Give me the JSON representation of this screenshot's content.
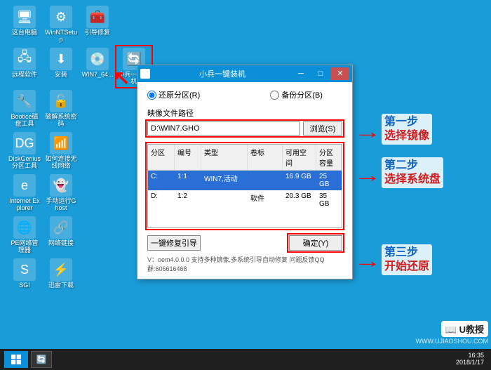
{
  "desktop_icons": [
    {
      "id": "this-pc",
      "label": "这台电脑",
      "row": 0,
      "col": 0,
      "glyph": "🖥"
    },
    {
      "id": "winntsetup",
      "label": "WinNTSetup",
      "row": 0,
      "col": 1,
      "glyph": "⚙"
    },
    {
      "id": "boot-repair",
      "label": "引导修复",
      "row": 0,
      "col": 2,
      "glyph": "🧰"
    },
    {
      "id": "remote-soft",
      "label": "远程软件",
      "row": 1,
      "col": 0,
      "glyph": "🖧"
    },
    {
      "id": "install",
      "label": "安装",
      "row": 1,
      "col": 1,
      "glyph": "⬇"
    },
    {
      "id": "win7-64",
      "label": "WIN7_64...",
      "row": 1,
      "col": 2,
      "glyph": "💿",
      "highlighted": false
    },
    {
      "id": "xiaobing",
      "label": "小兵一键装机",
      "row": 1,
      "col": 3,
      "glyph": "🔄",
      "highlighted": true
    },
    {
      "id": "bootice",
      "label": "Bootice磁盘工具",
      "row": 2,
      "col": 0,
      "glyph": "🔧"
    },
    {
      "id": "crack-pwd",
      "label": "破解系统密码",
      "row": 2,
      "col": 1,
      "glyph": "🔓"
    },
    {
      "id": "diskgenius",
      "label": "DiskGenius分区工具",
      "row": 3,
      "col": 0,
      "glyph": "DG"
    },
    {
      "id": "wifi",
      "label": "如何连接无线网络",
      "row": 3,
      "col": 1,
      "glyph": "📶"
    },
    {
      "id": "ie",
      "label": "Internet Explorer",
      "row": 4,
      "col": 0,
      "glyph": "e"
    },
    {
      "id": "ghost",
      "label": "手动运行Ghost",
      "row": 4,
      "col": 1,
      "glyph": "👻"
    },
    {
      "id": "netmgr",
      "label": "PE网络管理器",
      "row": 5,
      "col": 0,
      "glyph": "🌐"
    },
    {
      "id": "netlink",
      "label": "网络链接",
      "row": 5,
      "col": 1,
      "glyph": "🔗"
    },
    {
      "id": "sgi",
      "label": "SGI",
      "row": 6,
      "col": 0,
      "glyph": "S"
    },
    {
      "id": "xunlei",
      "label": "迅雷下载",
      "row": 6,
      "col": 1,
      "glyph": "⚡"
    }
  ],
  "dialog": {
    "title": "小兵一键装机",
    "radio_restore": "还原分区(R)",
    "radio_backup": "备份分区(B)",
    "path_label": "映像文件路径",
    "path_value": "D:\\WIN7.GHO",
    "browse": "浏览(S)",
    "columns": [
      "分区",
      "编号",
      "类型",
      "卷标",
      "可用空间",
      "分区容量"
    ],
    "rows": [
      {
        "drive": "C:",
        "idx": "1:1",
        "type": "WIN7,活动",
        "vol": "",
        "free": "16.9 GB",
        "size": "25 GB",
        "selected": true
      },
      {
        "drive": "D:",
        "idx": "1:2",
        "type": "",
        "vol": "软件",
        "free": "20.3 GB",
        "size": "35 GB",
        "selected": false
      }
    ],
    "btn_repair": "一键修复引导",
    "btn_ok": "确定(Y)",
    "footer": "V：oem4.0.0.0      支持多种镜像,多系统引导自动修复  问题反馈QQ群:606616468"
  },
  "callouts": {
    "step1": {
      "step": "第一步",
      "action": "选择镜像"
    },
    "step2": {
      "step": "第二步",
      "action": "选择系统盘"
    },
    "step3": {
      "step": "第三步",
      "action": "开始还原"
    }
  },
  "watermark": {
    "brand": "U教授",
    "url": "WWW.UJIAOSHOU.COM"
  },
  "taskbar": {
    "time": "16:35",
    "date": "2018/1/17"
  }
}
